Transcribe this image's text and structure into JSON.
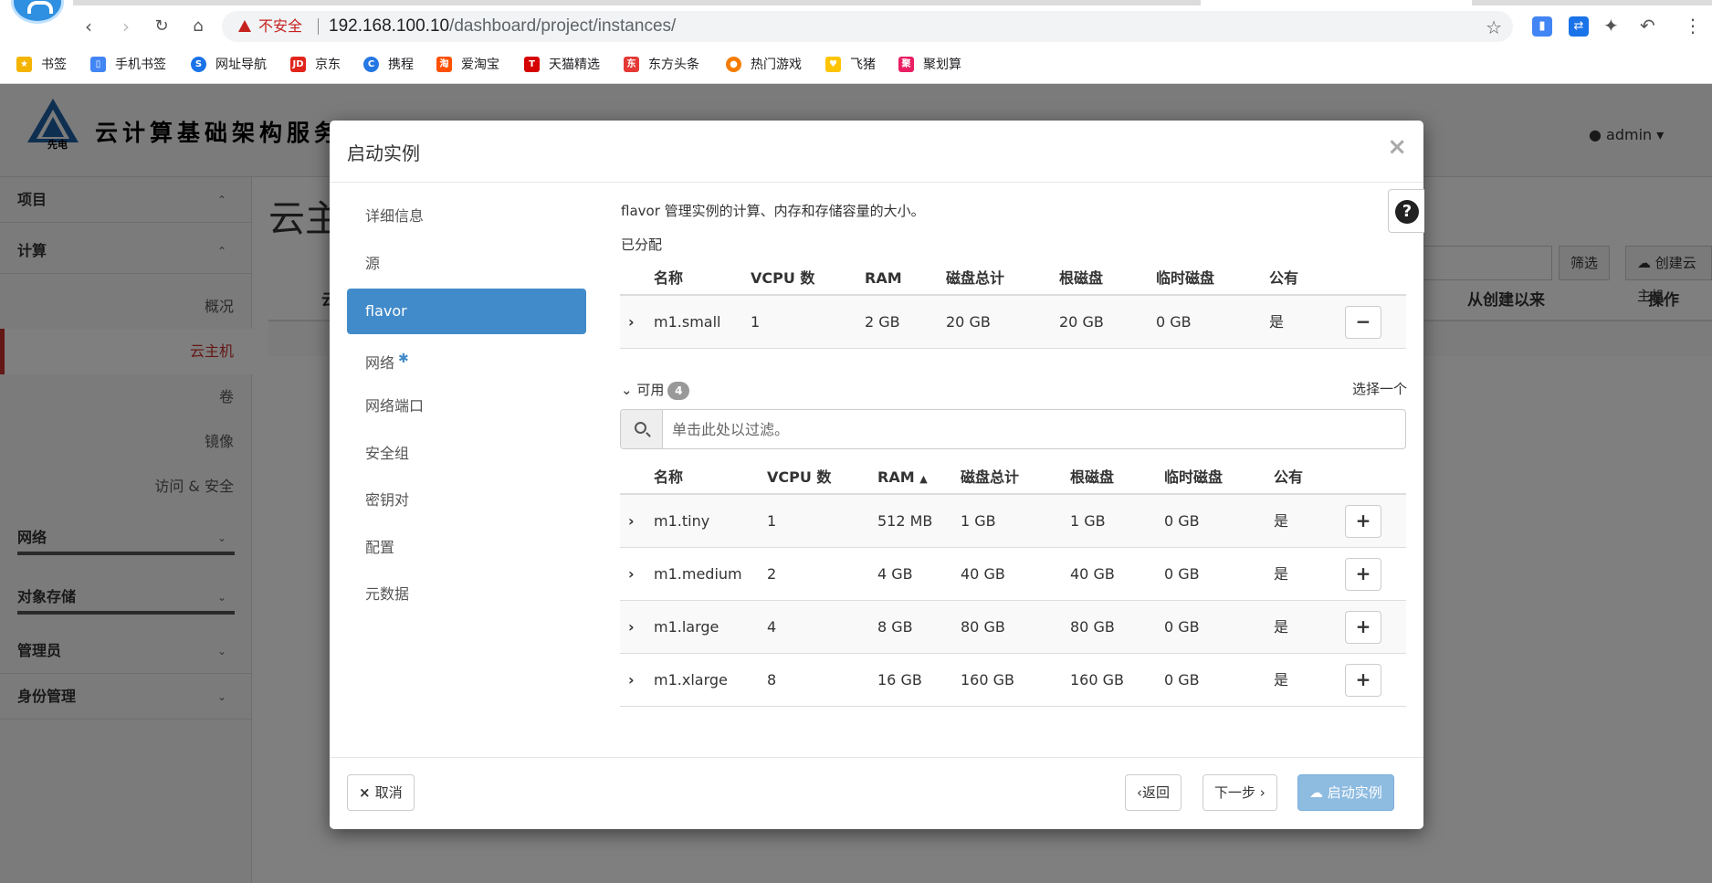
{
  "browser": {
    "security_label": "不安全",
    "url_host": "192.168.100.10",
    "url_path": "/dashboard/project/instances/",
    "bookmarks": [
      {
        "label": "书签",
        "icon": "star-icon",
        "color": "#f4b400"
      },
      {
        "label": "手机书签",
        "icon": "phone-icon",
        "color": "#4285f4"
      },
      {
        "label": "网址导航",
        "icon": "navigation-icon",
        "color": "#1a73e8"
      },
      {
        "label": "京东",
        "icon": "jd-icon",
        "color": "#e1251b"
      },
      {
        "label": "携程",
        "icon": "ctrip-icon",
        "color": "#2577e3"
      },
      {
        "label": "爱淘宝",
        "icon": "taobao-icon",
        "color": "#ff5000"
      },
      {
        "label": "天猫精选",
        "icon": "tmall-icon",
        "color": "#d50000"
      },
      {
        "label": "东方头条",
        "icon": "news-icon",
        "color": "#e53935"
      },
      {
        "label": "热门游戏",
        "icon": "game-icon",
        "color": "#f57c00"
      },
      {
        "label": "飞猪",
        "icon": "fliggy-icon",
        "color": "#ffc400"
      },
      {
        "label": "聚划算",
        "icon": "juhuasuan-icon",
        "color": "#e91e63"
      }
    ]
  },
  "header": {
    "brand_title": "云计算基础架构服务",
    "logo_text": "先电",
    "user": "admin"
  },
  "sidebar": {
    "groups": [
      {
        "label": "项目"
      },
      {
        "label": "计算"
      },
      {
        "label": "网络"
      },
      {
        "label": "对象存储"
      },
      {
        "label": "管理员"
      },
      {
        "label": "身份管理"
      }
    ],
    "items": [
      {
        "label": "概况"
      },
      {
        "label": "云主机"
      },
      {
        "label": "卷"
      },
      {
        "label": "镜像"
      },
      {
        "label": "访问 & 安全"
      }
    ]
  },
  "content": {
    "title": "云主",
    "filter_label": "筛选",
    "create_label": "创建云主机",
    "col_since": "从创建以来",
    "col_actions": "操作",
    "col_first": "云"
  },
  "modal": {
    "title": "启动实例",
    "nav": [
      {
        "label": "详细信息"
      },
      {
        "label": "源"
      },
      {
        "label": "flavor"
      },
      {
        "label": "网络"
      },
      {
        "label": "网络端口"
      },
      {
        "label": "安全组"
      },
      {
        "label": "密钥对"
      },
      {
        "label": "配置"
      },
      {
        "label": "元数据"
      }
    ],
    "description": "flavor 管理实例的计算、内存和存储容量的大小。",
    "allocated_label": "已分配",
    "columns": {
      "name": "名称",
      "vcpu": "VCPU 数",
      "ram": "RAM",
      "disk_total": "磁盘总计",
      "root_disk": "根磁盘",
      "ephemeral": "临时磁盘",
      "public": "公有"
    },
    "allocated": [
      {
        "name": "m1.small",
        "vcpu": "1",
        "ram": "2 GB",
        "disk_total": "20 GB",
        "root_disk": "20 GB",
        "ephemeral": "0 GB",
        "public": "是"
      }
    ],
    "available_label": "可用",
    "available_count": "4",
    "select_one": "选择一个",
    "search_placeholder": "单击此处以过滤。",
    "available": [
      {
        "name": "m1.tiny",
        "vcpu": "1",
        "ram": "512 MB",
        "disk_total": "1 GB",
        "root_disk": "1 GB",
        "ephemeral": "0 GB",
        "public": "是"
      },
      {
        "name": "m1.medium",
        "vcpu": "2",
        "ram": "4 GB",
        "disk_total": "40 GB",
        "root_disk": "40 GB",
        "ephemeral": "0 GB",
        "public": "是"
      },
      {
        "name": "m1.large",
        "vcpu": "4",
        "ram": "8 GB",
        "disk_total": "80 GB",
        "root_disk": "80 GB",
        "ephemeral": "0 GB",
        "public": "是"
      },
      {
        "name": "m1.xlarge",
        "vcpu": "8",
        "ram": "16 GB",
        "disk_total": "160 GB",
        "root_disk": "160 GB",
        "ephemeral": "0 GB",
        "public": "是"
      }
    ],
    "footer": {
      "cancel": "取消",
      "back": "返回",
      "next": "下一步",
      "launch": "启动实例"
    }
  }
}
